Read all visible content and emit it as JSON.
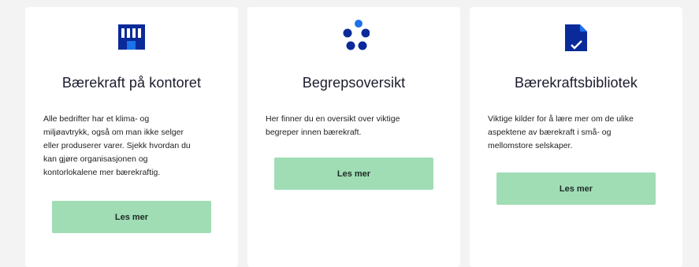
{
  "colors": {
    "background": "#f3f3f3",
    "card": "#ffffff",
    "icon_dark_blue": "#0a2a99",
    "icon_light_blue": "#1a73e8",
    "button_green": "#a0ddb5"
  },
  "cards": [
    {
      "icon": "office-building-icon",
      "title": "Bærekraft på kontoret",
      "lines": [
        "Alle bedrifter har et klima- og",
        "miljøavtrykk, også om man ikke selger",
        "eller produserer varer. Sjekk hvordan du",
        "kan gjøre organisasjonen og",
        "kontorlokalene mer bærekraftig."
      ],
      "button": "Les mer"
    },
    {
      "icon": "dots-cluster-icon",
      "title": "Begrepsoversikt",
      "lines": [
        "Her finner du en oversikt over viktige",
        "begreper innen bærekraft."
      ],
      "button": "Les mer"
    },
    {
      "icon": "document-check-icon",
      "title": "Bærekraftsbibliotek",
      "lines": [
        "Viktige kilder for å lære mer om de ulike",
        "aspektene av bærekraft i små- og",
        "mellomstore selskaper."
      ],
      "button": "Les mer"
    }
  ]
}
